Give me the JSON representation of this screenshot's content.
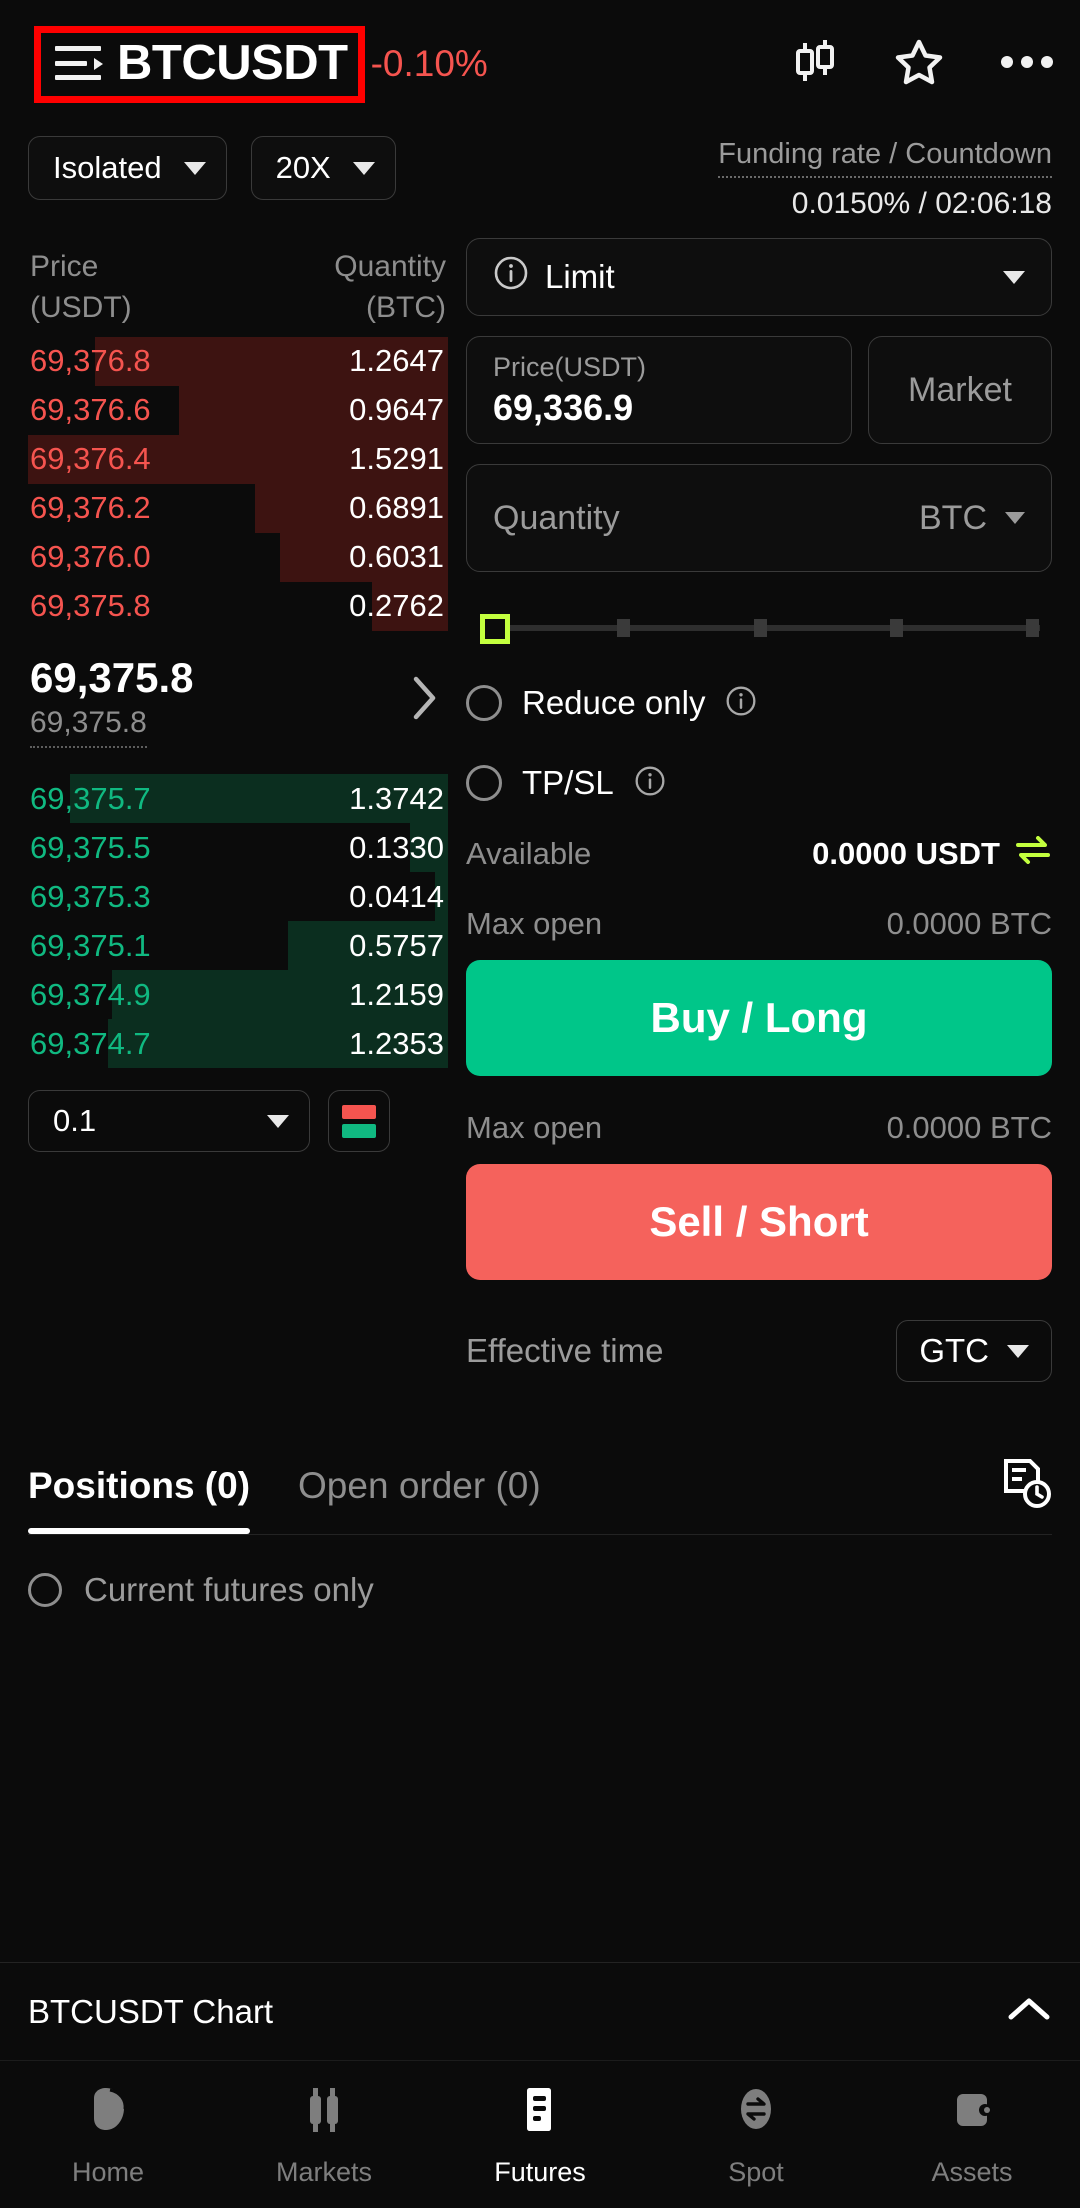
{
  "header": {
    "pair": "BTCUSDT",
    "change": "-0.10%",
    "change_color": "#f5544f",
    "icons": {
      "menu": "hamburger-icon",
      "chart": "candlestick-chart-icon",
      "favorite": "star-icon",
      "more": "more-options-icon"
    }
  },
  "controls": {
    "margin_mode": "Isolated",
    "leverage": "20X",
    "funding_label": "Funding rate / Countdown",
    "funding_value": "0.0150% / 02:06:18"
  },
  "orderbook": {
    "header_price": "Price",
    "header_price_unit": "(USDT)",
    "header_qty": "Quantity",
    "header_qty_unit": "(BTC)",
    "asks": [
      {
        "price": "69,376.8",
        "qty": "1.2647",
        "depth": 84
      },
      {
        "price": "69,376.6",
        "qty": "0.9647",
        "depth": 64
      },
      {
        "price": "69,376.4",
        "qty": "1.5291",
        "depth": 100
      },
      {
        "price": "69,376.2",
        "qty": "0.6891",
        "depth": 46
      },
      {
        "price": "69,376.0",
        "qty": "0.6031",
        "depth": 40
      },
      {
        "price": "69,375.8",
        "qty": "0.2762",
        "depth": 18
      }
    ],
    "bids": [
      {
        "price": "69,375.7",
        "qty": "1.3742",
        "depth": 90
      },
      {
        "price": "69,375.5",
        "qty": "0.1330",
        "depth": 9
      },
      {
        "price": "69,375.3",
        "qty": "0.0414",
        "depth": 3
      },
      {
        "price": "69,375.1",
        "qty": "0.5757",
        "depth": 38
      },
      {
        "price": "69,374.9",
        "qty": "1.2159",
        "depth": 80
      },
      {
        "price": "69,374.7",
        "qty": "1.2353",
        "depth": 81
      }
    ],
    "last_price": "69,375.8",
    "index_price": "69,375.8",
    "tick_size": "0.1",
    "ask_color": "#f5544f",
    "bid_color": "#10b981"
  },
  "order_form": {
    "order_type": "Limit",
    "price_label": "Price(USDT)",
    "price_value": "69,336.9",
    "market_label": "Market",
    "quantity_placeholder": "Quantity",
    "quantity_unit": "BTC",
    "slider_percent": 0,
    "reduce_only": "Reduce only",
    "tpsl": "TP/SL",
    "available_label": "Available",
    "available_value": "0.0000 USDT",
    "max_open_label": "Max open",
    "max_open_buy": "0.0000  BTC",
    "max_open_sell": "0.0000  BTC",
    "buy_label": "Buy / Long",
    "sell_label": "Sell / Short",
    "effective_time_label": "Effective time",
    "effective_time_value": "GTC",
    "buy_color": "#00c689",
    "sell_color": "#f5625c",
    "accent_lime": "#c3ff3e"
  },
  "tabs": {
    "positions": "Positions (0)",
    "open_order": "Open order  (0)",
    "history_icon": "order-history-icon",
    "current_futures_only": "Current futures only"
  },
  "chart_bar": {
    "label": "BTCUSDT Chart"
  },
  "bottom_nav": {
    "items": [
      {
        "label": "Home",
        "icon": "home-icon",
        "active": false
      },
      {
        "label": "Markets",
        "icon": "markets-candles-icon",
        "active": false
      },
      {
        "label": "Futures",
        "icon": "futures-icon",
        "active": true
      },
      {
        "label": "Spot",
        "icon": "spot-swap-icon",
        "active": false
      },
      {
        "label": "Assets",
        "icon": "wallet-icon",
        "active": false
      }
    ]
  }
}
